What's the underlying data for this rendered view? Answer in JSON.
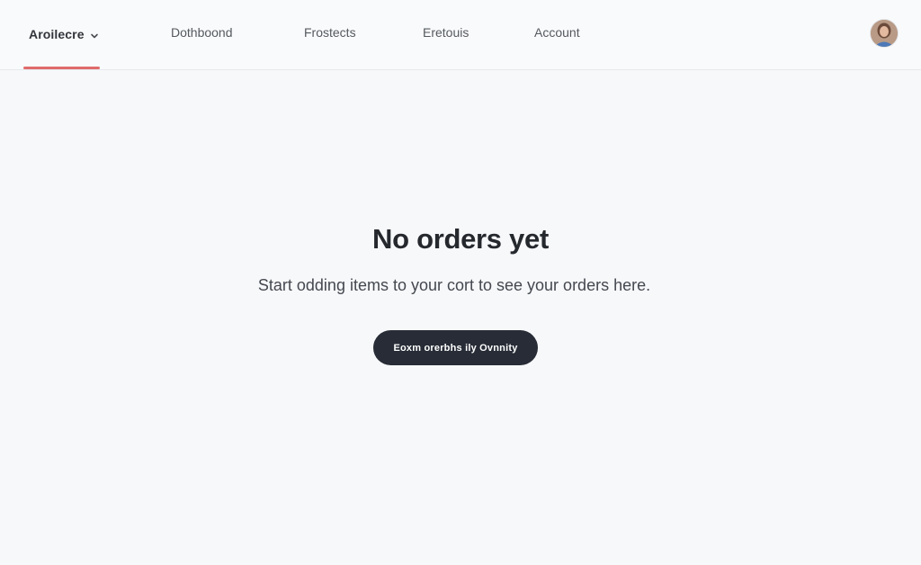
{
  "nav": {
    "brand_label": "Aroilecre",
    "brand_icon": "chevron-down-icon",
    "items": [
      {
        "label": "Dothboond"
      },
      {
        "label": "Frostects"
      },
      {
        "label": "Eretouis"
      },
      {
        "label": "Account"
      }
    ],
    "active_indicator_color": "#e06b6b",
    "avatar_icon": "user-avatar"
  },
  "empty_state": {
    "title": "No orders yet",
    "subtitle": "Start odding items to your cort to see your orders here.",
    "button_label": "Eoxm orerbhs ily Ovnnity"
  },
  "colors": {
    "background": "#f7f8fa",
    "button_bg": "#272c36",
    "button_text": "#ffffff"
  }
}
